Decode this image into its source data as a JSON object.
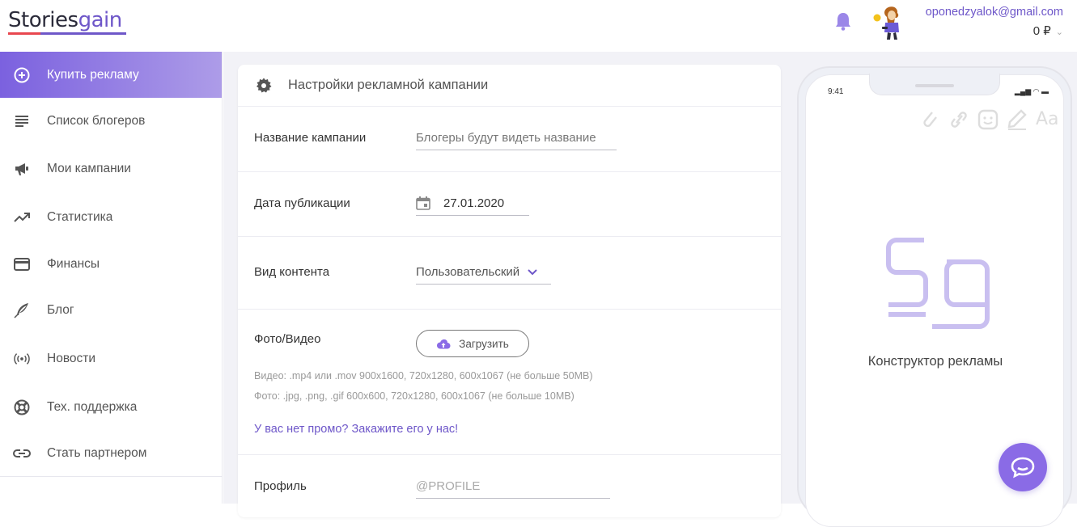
{
  "header": {
    "logo_part1": "Stories",
    "logo_part2": "gain",
    "email": "oponedzyalok@gmail.com",
    "balance": "0 ₽",
    "balance_chevron": "⌄"
  },
  "sidebar": {
    "items": [
      {
        "label": "Купить рекламу",
        "icon": "plus-circle-icon",
        "active": true
      },
      {
        "label": "Список блогеров",
        "icon": "list-icon"
      },
      {
        "label": "Мои кампании",
        "icon": "megaphone-icon"
      },
      {
        "label": "Статистика",
        "icon": "trending-up-icon"
      },
      {
        "label": "Финансы",
        "icon": "credit-card-icon"
      },
      {
        "label": "Блог",
        "icon": "feather-icon"
      },
      {
        "label": "Новости",
        "icon": "broadcast-icon"
      },
      {
        "label": "Тех. поддержка",
        "icon": "lifebuoy-icon"
      },
      {
        "label": "Стать партнером",
        "icon": "link-icon"
      }
    ]
  },
  "form": {
    "title": "Настройки рекламной кампании",
    "campaign_name_label": "Название кампании",
    "campaign_name_placeholder": "Блогеры будут видеть название",
    "date_label": "Дата публикации",
    "date_value": "27.01.2020",
    "content_type_label": "Вид контента",
    "content_type_value": "Пользовательский",
    "media_label": "Фото/Видео",
    "upload_label": "Загрузить",
    "hint_video": "Видео:  .mp4 или .mov 900x1600, 720x1280, 600x1067 (не больше 50MB)",
    "hint_photo": "Фото:     .jpg, .png, .gif 600x600, 720x1280, 600x1067 (не больше 10MB)",
    "promo_link": "У вас нет промо? Закажите его у нас!",
    "profile_label": "Профиль",
    "profile_placeholder": "@PROFILE"
  },
  "phone": {
    "time": "9:41",
    "status": "▂▄▆ ◠ ▬",
    "constructor_label": "Конструктор рекламы",
    "tool_text": "Aa"
  },
  "colors": {
    "accent": "#6e57c9",
    "sidebar_active_start": "#7b61df",
    "sidebar_active_end": "#ad9ce8",
    "chat_button": "#8a6be6",
    "bell": "#9b87e8",
    "logo_mark": "#c9bff0"
  }
}
